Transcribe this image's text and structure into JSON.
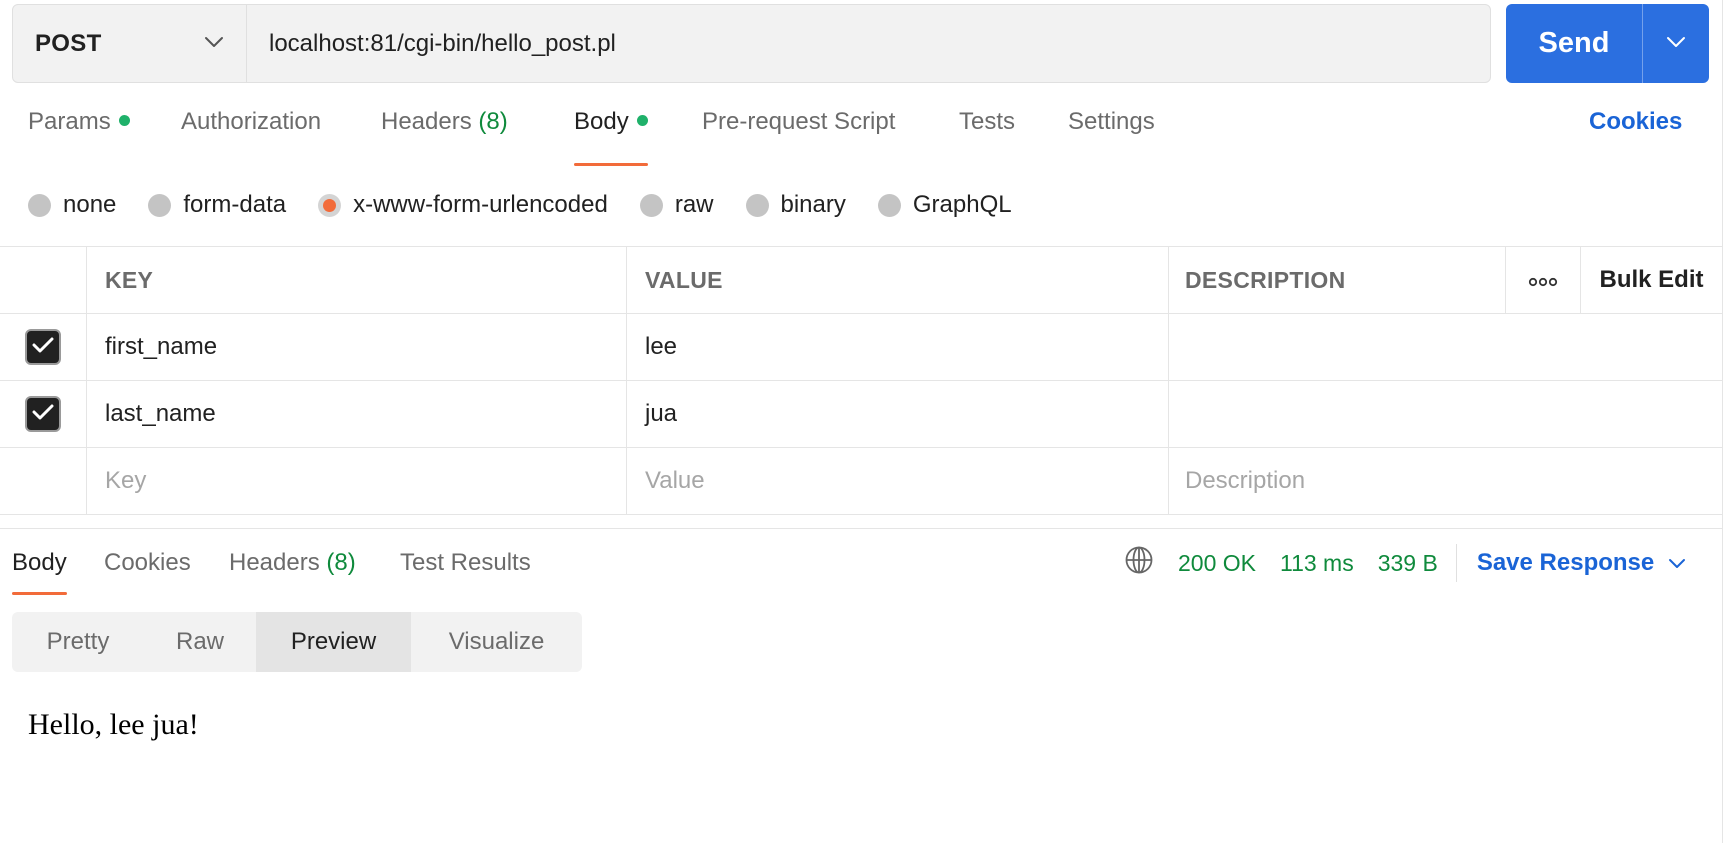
{
  "request": {
    "method": "POST",
    "url": "localhost:81/cgi-bin/hello_post.pl",
    "send_label": "Send"
  },
  "tabs": {
    "params": "Params",
    "authorization": "Authorization",
    "headers": "Headers",
    "headers_count": "(8)",
    "body": "Body",
    "prerequest": "Pre-request Script",
    "tests": "Tests",
    "settings": "Settings",
    "cookies": "Cookies",
    "active": "Body"
  },
  "body_types": {
    "none": "none",
    "form_data": "form-data",
    "urlencoded": "x-www-form-urlencoded",
    "raw": "raw",
    "binary": "binary",
    "graphql": "GraphQL",
    "selected": "x-www-form-urlencoded"
  },
  "table": {
    "headers": {
      "key": "KEY",
      "value": "VALUE",
      "description": "DESCRIPTION",
      "bulk_edit": "Bulk Edit"
    },
    "rows": [
      {
        "checked": true,
        "key": "first_name",
        "value": "lee",
        "description": ""
      },
      {
        "checked": true,
        "key": "last_name",
        "value": "jua",
        "description": ""
      }
    ],
    "placeholders": {
      "key": "Key",
      "value": "Value",
      "description": "Description"
    }
  },
  "response": {
    "tabs": {
      "body": "Body",
      "cookies": "Cookies",
      "headers": "Headers",
      "headers_count": "(8)",
      "test_results": "Test Results"
    },
    "status": "200 OK",
    "time": "113 ms",
    "size": "339 B",
    "save_label": "Save Response",
    "views": {
      "pretty": "Pretty",
      "raw": "Raw",
      "preview": "Preview",
      "visualize": "Visualize",
      "active": "Preview"
    },
    "preview_text": "Hello, lee jua!"
  },
  "colors": {
    "accent": "#f26b3a",
    "primary": "#2b6fe0",
    "success": "#0f8a3c",
    "link": "#1a64d6"
  }
}
